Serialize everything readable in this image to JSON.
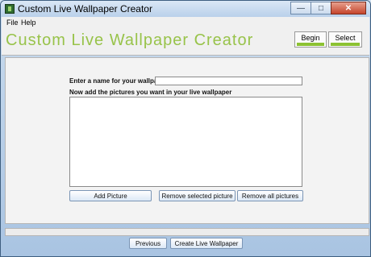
{
  "window": {
    "title": "Custom Live Wallpaper Creator"
  },
  "menu": {
    "items": [
      "File",
      "Help"
    ]
  },
  "header": {
    "banner": "Custom Live Wallpaper Creator",
    "steps": [
      {
        "label": "Begin"
      },
      {
        "label": "Select"
      }
    ],
    "accent_color": "#8cc232"
  },
  "form": {
    "name_label": "Enter a name for your wallpaper:",
    "name_value": "",
    "pictures_label": "Now add the pictures you want in your live wallpaper",
    "pictures": [],
    "buttons": {
      "add": "Add Picture",
      "remove_selected": "Remove selected picture",
      "remove_all": "Remove all pictures"
    }
  },
  "footer": {
    "previous": "Previous",
    "create": "Create Live Wallpaper"
  }
}
